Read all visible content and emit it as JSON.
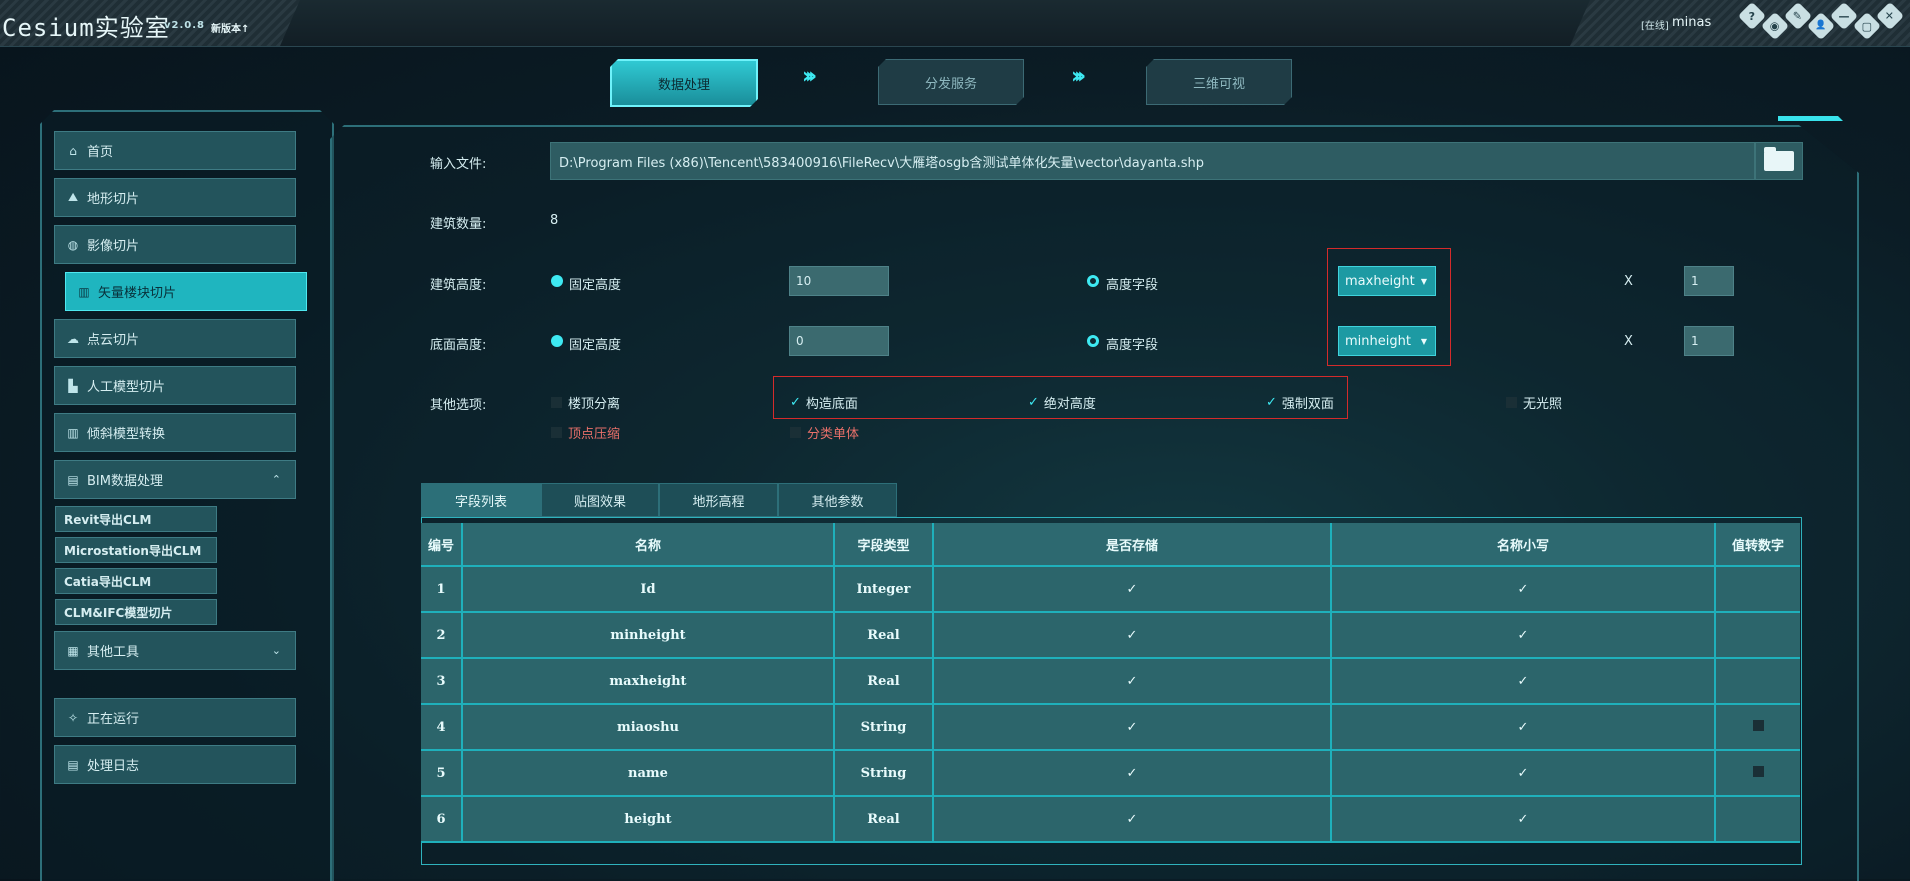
{
  "app": {
    "title": "Cesium实验室",
    "version": "v2.0.8",
    "new_version": "新版本↑"
  },
  "user": {
    "status": "[在线]",
    "name": "minas"
  },
  "window_icons": [
    "help-icon",
    "grid-icon",
    "tools-icon",
    "user-icon",
    "minimize-icon",
    "maximize-icon",
    "close-icon"
  ],
  "window_glyphs": [
    "?",
    "◉",
    "✎",
    "👤",
    "—",
    "▢",
    "✕"
  ],
  "steps": [
    "数据处理",
    "分发服务",
    "三维可视"
  ],
  "step_arrows": "›››",
  "sidebar": {
    "items": [
      {
        "label": "首页",
        "icon": "⌂"
      },
      {
        "label": "地形切片",
        "icon": "⛰"
      },
      {
        "label": "影像切片",
        "icon": "◍"
      },
      {
        "label": "矢量楼块切片",
        "icon": "▥"
      },
      {
        "label": "点云切片",
        "icon": "☁"
      },
      {
        "label": "人工模型切片",
        "icon": "▙"
      },
      {
        "label": "倾斜模型转换",
        "icon": "▥"
      },
      {
        "label": "BIM数据处理",
        "icon": "▤",
        "chevron": "⌃"
      },
      {
        "label": "其他工具",
        "icon": "▦",
        "chevron": "⌄"
      },
      {
        "label": "正在运行",
        "icon": "✧"
      },
      {
        "label": "处理日志",
        "icon": "▤"
      }
    ],
    "sub_items": [
      "Revit导出CLM",
      "Microstation导出CLM",
      "Catia导出CLM",
      "CLM&IFC模型切片"
    ]
  },
  "form": {
    "input_file_label": "输入文件:",
    "input_file_value": "D:\\Program Files (x86)\\Tencent\\583400916\\FileRecv\\大雁塔osgb含测试单体化矢量\\vector\\dayanta.shp",
    "building_count_label": "建筑数量:",
    "building_count_value": "8",
    "height_label": "建筑高度:",
    "base_label": "底面高度:",
    "fixed_height": "固定高度",
    "height_field": "高度字段",
    "height_value": "10",
    "base_value": "0",
    "height_select": "maxheight",
    "base_select": "minheight",
    "multiply": "X",
    "height_factor": "1",
    "base_factor": "1",
    "caret": "▼",
    "other_label": "其他选项:",
    "options": [
      {
        "label": "楼顶分离",
        "checked": false
      },
      {
        "label": "构造底面",
        "checked": true
      },
      {
        "label": "绝对高度",
        "checked": true
      },
      {
        "label": "强制双面",
        "checked": true
      },
      {
        "label": "无光照",
        "checked": false
      },
      {
        "label": "顶点压缩",
        "checked": false
      },
      {
        "label": "分类单体",
        "checked": false
      }
    ],
    "check_mark": "✓"
  },
  "tabs": [
    "字段列表",
    "贴图效果",
    "地形高程",
    "其他参数"
  ],
  "table": {
    "headers": [
      "编号",
      "名称",
      "字段类型",
      "是否存储",
      "名称小写",
      "值转数字"
    ],
    "rows": [
      {
        "no": "1",
        "name": "Id",
        "type": "Integer",
        "store": true,
        "lower": true,
        "to_num": false
      },
      {
        "no": "2",
        "name": "minheight",
        "type": "Real",
        "store": true,
        "lower": true,
        "to_num": false
      },
      {
        "no": "3",
        "name": "maxheight",
        "type": "Real",
        "store": true,
        "lower": true,
        "to_num": false
      },
      {
        "no": "4",
        "name": "miaoshu",
        "type": "String",
        "store": true,
        "lower": true,
        "to_num": "box"
      },
      {
        "no": "5",
        "name": "name",
        "type": "String",
        "store": true,
        "lower": true,
        "to_num": "box"
      },
      {
        "no": "6",
        "name": "height",
        "type": "Real",
        "store": true,
        "lower": true,
        "to_num": false
      }
    ]
  }
}
